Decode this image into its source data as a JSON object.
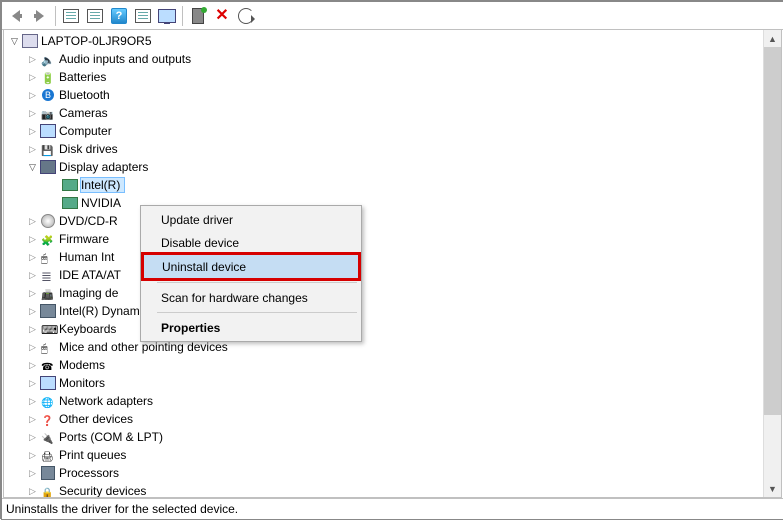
{
  "toolbar": {
    "back": "Back",
    "forward": "Forward",
    "show_hidden": "Show hidden devices",
    "properties": "Properties",
    "help": "Help",
    "refresh": "Scan for hardware changes",
    "update": "Update driver",
    "add": "Add legacy hardware",
    "uninstall": "Uninstall device",
    "scan": "Scan"
  },
  "tree": {
    "root": "LAPTOP-0LJR9OR5",
    "items": [
      {
        "label": "Audio inputs and outputs",
        "icon": "sound",
        "exp": "closed"
      },
      {
        "label": "Batteries",
        "icon": "batt",
        "exp": "closed"
      },
      {
        "label": "Bluetooth",
        "icon": "bt",
        "exp": "closed"
      },
      {
        "label": "Cameras",
        "icon": "cam",
        "exp": "closed"
      },
      {
        "label": "Computer",
        "icon": "comp",
        "exp": "closed"
      },
      {
        "label": "Disk drives",
        "icon": "disk",
        "exp": "closed"
      },
      {
        "label": "Display adapters",
        "icon": "disp",
        "exp": "open",
        "children": [
          {
            "label": "Intel(R)",
            "full": "Intel(R) HD Graphics",
            "icon": "gpu",
            "selected": true
          },
          {
            "label": "NVIDIA",
            "full": "NVIDIA GeForce",
            "icon": "gpu"
          }
        ]
      },
      {
        "label": "DVD/CD-R",
        "full": "DVD/CD-ROM drives",
        "icon": "dvd",
        "exp": "closed"
      },
      {
        "label": "Firmware",
        "icon": "fw",
        "exp": "closed"
      },
      {
        "label": "Human Int",
        "full": "Human Interface Devices",
        "icon": "hid",
        "exp": "closed"
      },
      {
        "label": "IDE ATA/AT",
        "full": "IDE ATA/ATAPI controllers",
        "icon": "ata",
        "exp": "closed"
      },
      {
        "label": "Imaging de",
        "full": "Imaging devices",
        "icon": "img",
        "exp": "closed"
      },
      {
        "label": "Intel(R) Dynamic Platform and Thermal Framework",
        "icon": "chip",
        "exp": "closed"
      },
      {
        "label": "Keyboards",
        "icon": "kb",
        "exp": "closed"
      },
      {
        "label": "Mice and other pointing devices",
        "icon": "mouse",
        "exp": "closed"
      },
      {
        "label": "Modems",
        "icon": "modem",
        "exp": "closed"
      },
      {
        "label": "Monitors",
        "icon": "comp",
        "exp": "closed"
      },
      {
        "label": "Network adapters",
        "icon": "net",
        "exp": "closed"
      },
      {
        "label": "Other devices",
        "icon": "other",
        "exp": "closed"
      },
      {
        "label": "Ports (COM & LPT)",
        "icon": "port",
        "exp": "closed"
      },
      {
        "label": "Print queues",
        "icon": "print",
        "exp": "closed"
      },
      {
        "label": "Processors",
        "icon": "cpu",
        "exp": "closed"
      },
      {
        "label": "Security devices",
        "icon": "sec",
        "exp": "closed"
      }
    ]
  },
  "context_menu": {
    "update": "Update driver",
    "disable": "Disable device",
    "uninstall": "Uninstall device",
    "scan": "Scan for hardware changes",
    "properties": "Properties",
    "highlighted": "uninstall"
  },
  "status": "Uninstalls the driver for the selected device."
}
